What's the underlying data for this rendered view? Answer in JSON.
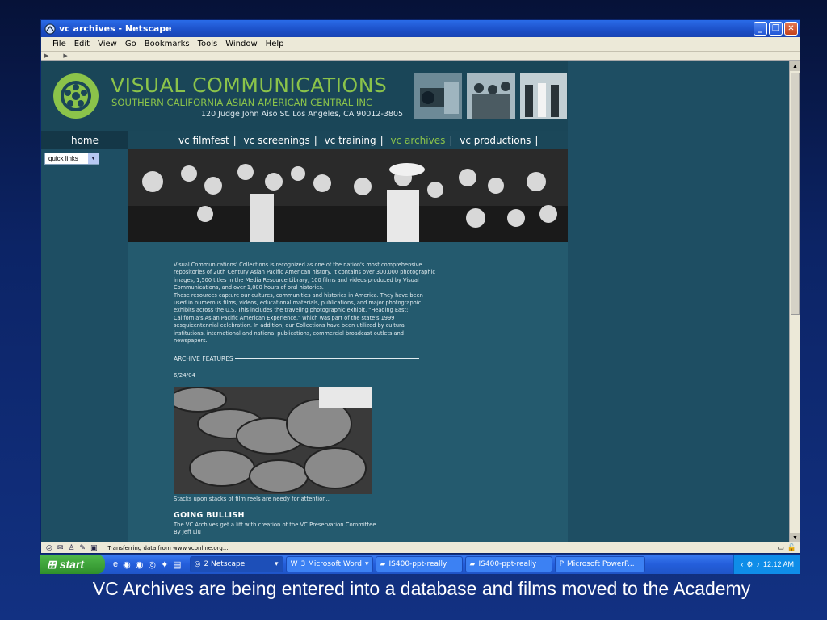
{
  "window": {
    "title": "vc archives - Netscape",
    "buttons": {
      "minimize": "_",
      "restore": "❐",
      "close": "✕"
    }
  },
  "menu": [
    "File",
    "Edit",
    "View",
    "Go",
    "Bookmarks",
    "Tools",
    "Window",
    "Help"
  ],
  "site": {
    "org_name": "VISUAL COMMUNICATIONS",
    "org_sub": "SOUTHERN CALIFORNIA ASIAN AMERICAN CENTRAL INC",
    "address": "120 Judge John Aiso St. Los Angeles, CA 90012-3805",
    "nav_home": "home",
    "nav_links": [
      "vc filmfest",
      "vc screenings",
      "vc training",
      "vc archives",
      "vc productions"
    ],
    "nav_active": "vc archives",
    "quick_links": "quick links",
    "body_text": "Visual Communications' Collections is recognized as one of the nation's most comprehensive repositories of 20th Century Asian Pacific American history. It contains over 300,000 photographic images, 1,500 titles in the Media Resource Library, 100 films and videos produced by Visual Communications, and over 1,000 hours of oral histories.",
    "body_text2": "These resources capture our cultures, communities and histories in America. They have been used in numerous films, videos, educational materials, publications, and major photographic exhibits across the U.S. This includes the traveling photographic exhibit, \"Heading East: California's Asian Pacific American Experience,\" which was part of the state's 1999 sesquicentennial celebration. In addition, our Collections have been utilized by cultural institutions, international and national publications, commercial broadcast outlets and newspapers.",
    "features_heading": "ARCHIVE FEATURES",
    "feature_date": "6/24/04",
    "photo_caption": "Stacks upon stacks of film reels are needy for attention..",
    "story_title": "GOING BULLISH",
    "story_sub": "The VC Archives get a lift with creation of the VC Preservation Committee",
    "story_byline": "By Jeff Liu"
  },
  "status": {
    "text": "Transferring data from www.vconline.org..."
  },
  "taskbar": {
    "start": "start",
    "tasks": [
      "2 Netscape",
      "3 Microsoft Word",
      "IS400-ppt-really",
      "IS400-ppt-really",
      "Microsoft PowerP..."
    ],
    "clock": "12:12 AM"
  },
  "slide_caption": "VC Archives are being entered into a database and films moved to the Academy",
  "colors": {
    "brand_green": "#8bc34a",
    "page_teal": "#1e4e63",
    "slide_bg": "#0c2466"
  }
}
